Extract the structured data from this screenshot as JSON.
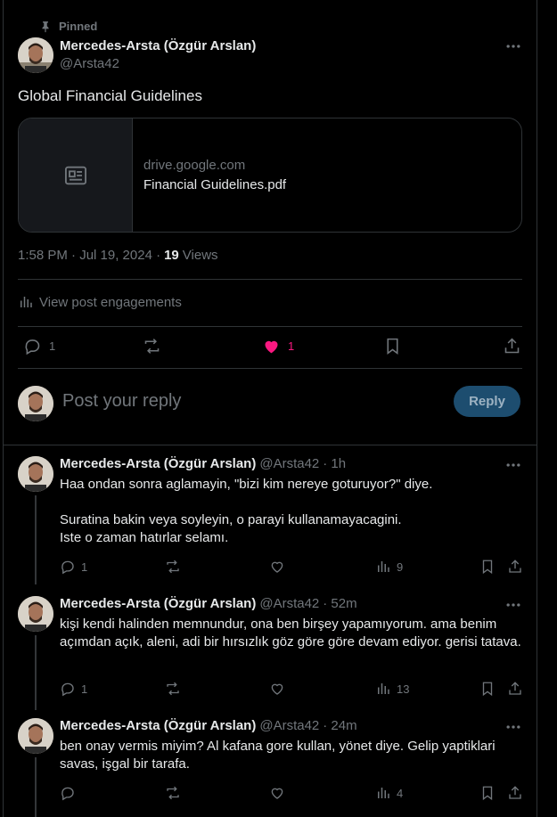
{
  "main_post": {
    "pinned_label": "Pinned",
    "author_name": "Mercedes-Arsta (Özgür Arslan)",
    "author_handle": "@Arsta42",
    "text": "Global Financial Guidelines",
    "card": {
      "domain": "drive.google.com",
      "title": "Financial Guidelines.pdf"
    },
    "time": "1:58 PM · Jul 19, 2024 ·",
    "views_count": "19",
    "views_label": "Views",
    "engagements_label": "View post engagements",
    "actions": {
      "reply_count": "1",
      "like_count": "1"
    }
  },
  "reply_box": {
    "placeholder": "Post your reply",
    "button_label": "Reply"
  },
  "replies": [
    {
      "author_name": "Mercedes-Arsta (Özgür Arslan)",
      "handle": "@Arsta42",
      "time": "· 1h",
      "text": "Haa ondan sonra aglamayin, \"bizi kim nereye goturuyor?\" diye.\n\nSuratina bakin veya soyleyin, o parayi kullanamayacagini.\nIste o zaman hatırlar selamı.",
      "reply_count": "1",
      "views": "9"
    },
    {
      "author_name": "Mercedes-Arsta (Özgür Arslan)",
      "handle": "@Arsta42",
      "time": "· 52m",
      "text": "kişi kendi halinden memnundur, ona ben birşey yapamıyorum. ama benim açımdan açık, aleni, adi bir hırsızlık göz göre göre devam ediyor. gerisi tatava.",
      "reply_count": "1",
      "views": "13"
    },
    {
      "author_name": "Mercedes-Arsta (Özgür Arslan)",
      "handle": "@Arsta42",
      "time": "· 24m",
      "text": "ben onay vermis miyim? Al kafana gore kullan, yönet diye. Gelip yaptiklari savas, işgal bir tarafa.",
      "reply_count": "",
      "views": "4"
    }
  ],
  "colors": {
    "like_active": "#f91880",
    "reply_button_bg": "#1d4d6f",
    "muted": "#71767b"
  }
}
